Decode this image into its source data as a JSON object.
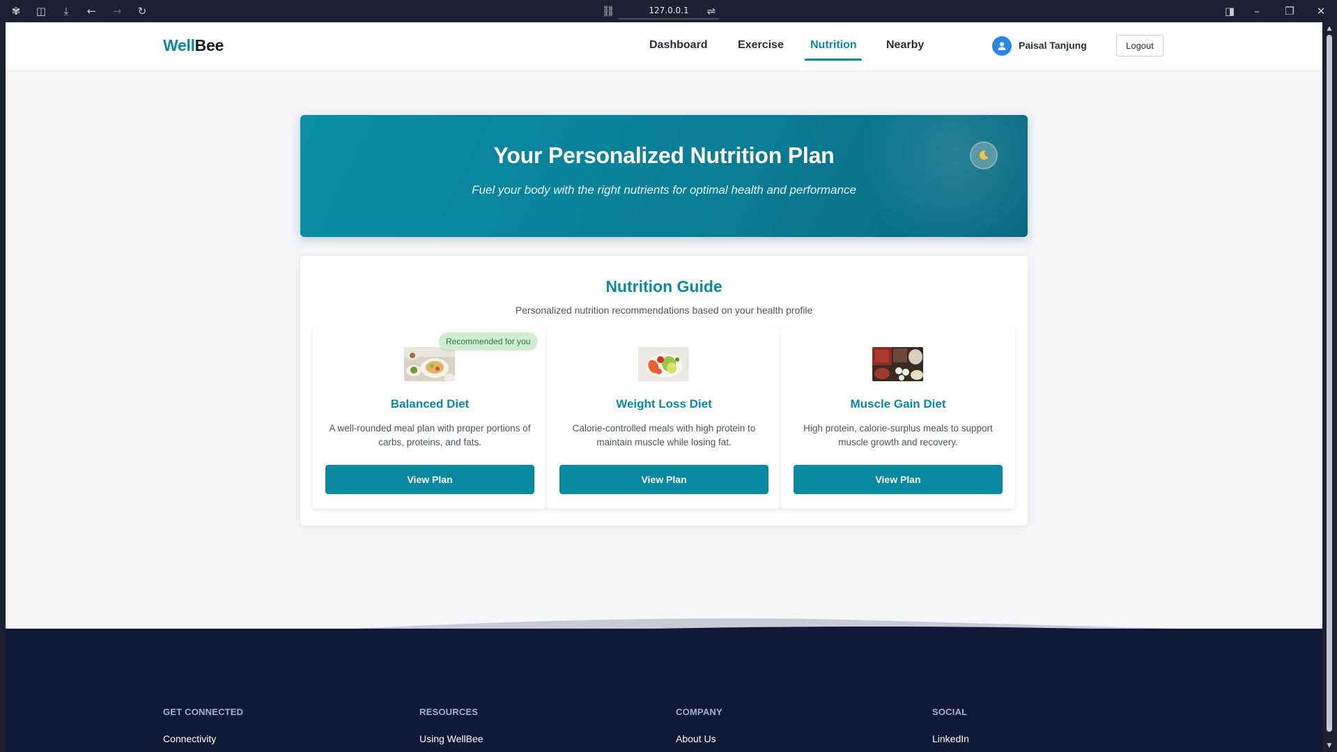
{
  "browser": {
    "url": "127.0.0.1"
  },
  "nav": {
    "logo_part1": "Well",
    "logo_part2": "Bee",
    "links": [
      "Dashboard",
      "Exercise",
      "Nutrition",
      "Nearby"
    ],
    "active": "Nutrition",
    "user_name": "Paisal Tanjung",
    "logout_label": "Logout"
  },
  "hero": {
    "title": "Your Personalized Nutrition Plan",
    "subtitle": "Fuel your body with the right nutrients for optimal health and performance",
    "toggle_icon": "moon-icon"
  },
  "guide": {
    "title": "Nutrition Guide",
    "subtitle": "Personalized nutrition recommendations based on your health profile",
    "cards": [
      {
        "title": "Balanced Diet",
        "description": "A well-rounded meal plan with proper portions of carbs, proteins, and fats.",
        "button": "View Plan",
        "badge": "Recommended for you"
      },
      {
        "title": "Weight Loss Diet",
        "description": "Calorie-controlled meals with high protein to maintain muscle while losing fat.",
        "button": "View Plan"
      },
      {
        "title": "Muscle Gain Diet",
        "description": "High protein, calorie-surplus meals to support muscle growth and recovery.",
        "button": "View Plan"
      }
    ]
  },
  "footer": {
    "columns": [
      {
        "heading": "GET CONNECTED",
        "first_link": "Connectivity"
      },
      {
        "heading": "RESOURCES",
        "first_link": "Using WellBee"
      },
      {
        "heading": "COMPANY",
        "first_link": "About Us"
      },
      {
        "heading": "SOCIAL",
        "first_link": "LinkedIn"
      }
    ]
  },
  "colors": {
    "brand": "#0a8aa2",
    "footer_bg": "#101a36",
    "badge_bg": "#cfeecf"
  }
}
